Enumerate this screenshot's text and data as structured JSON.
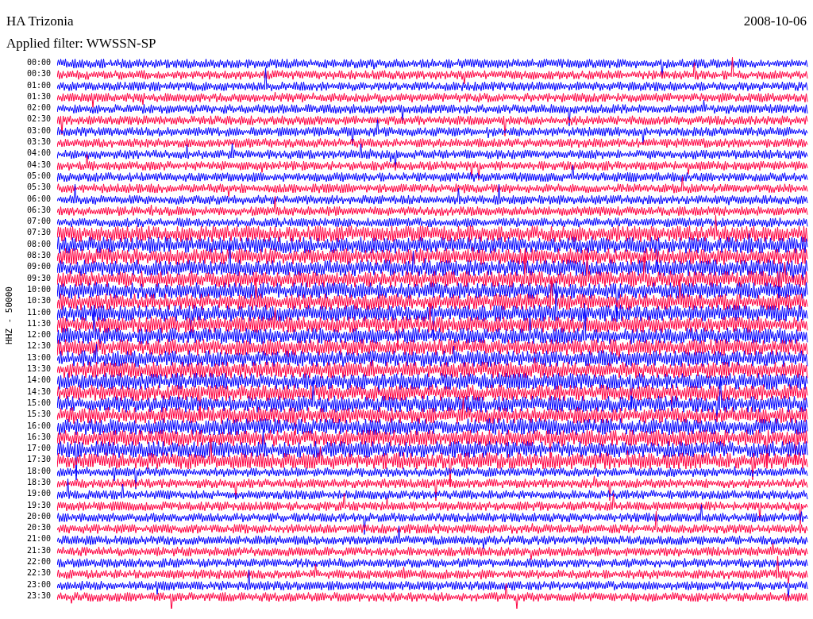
{
  "header": {
    "station": "HA Trizonia",
    "date": "2008-10-06",
    "filter": "Applied filter: WWSSN-SP"
  },
  "axis_label": "HHZ - 50000",
  "rows": [
    {
      "time": "00:00",
      "color": "#0000ff"
    },
    {
      "time": "00:30",
      "color": "#ff0040"
    },
    {
      "time": "01:00",
      "color": "#0000ff"
    },
    {
      "time": "01:30",
      "color": "#ff0040"
    },
    {
      "time": "02:00",
      "color": "#0000ff"
    },
    {
      "time": "02:30",
      "color": "#ff0040"
    },
    {
      "time": "03:00",
      "color": "#0000ff"
    },
    {
      "time": "03:30",
      "color": "#ff0040"
    },
    {
      "time": "04:00",
      "color": "#0000ff"
    },
    {
      "time": "04:30",
      "color": "#ff0040"
    },
    {
      "time": "05:00",
      "color": "#0000ff"
    },
    {
      "time": "05:30",
      "color": "#ff0040"
    },
    {
      "time": "06:00",
      "color": "#0000ff"
    },
    {
      "time": "06:30",
      "color": "#ff0040"
    },
    {
      "time": "07:00",
      "color": "#0000ff"
    },
    {
      "time": "07:30",
      "color": "#ff0040"
    },
    {
      "time": "08:00",
      "color": "#0000ff"
    },
    {
      "time": "08:30",
      "color": "#ff0040"
    },
    {
      "time": "09:00",
      "color": "#0000ff"
    },
    {
      "time": "09:30",
      "color": "#ff0040"
    },
    {
      "time": "10:00",
      "color": "#0000ff"
    },
    {
      "time": "10:30",
      "color": "#ff0040"
    },
    {
      "time": "11:00",
      "color": "#0000ff"
    },
    {
      "time": "11:30",
      "color": "#ff0040"
    },
    {
      "time": "12:00",
      "color": "#0000ff"
    },
    {
      "time": "12:30",
      "color": "#ff0040"
    },
    {
      "time": "13:00",
      "color": "#0000ff"
    },
    {
      "time": "13:30",
      "color": "#ff0040"
    },
    {
      "time": "14:00",
      "color": "#0000ff"
    },
    {
      "time": "14:30",
      "color": "#ff0040"
    },
    {
      "time": "15:00",
      "color": "#0000ff"
    },
    {
      "time": "15:30",
      "color": "#ff0040"
    },
    {
      "time": "16:00",
      "color": "#0000ff"
    },
    {
      "time": "16:30",
      "color": "#ff0040"
    },
    {
      "time": "17:00",
      "color": "#0000ff"
    },
    {
      "time": "17:30",
      "color": "#ff0040"
    },
    {
      "time": "18:00",
      "color": "#0000ff"
    },
    {
      "time": "18:30",
      "color": "#ff0040"
    },
    {
      "time": "19:00",
      "color": "#0000ff"
    },
    {
      "time": "19:30",
      "color": "#ff0040"
    },
    {
      "time": "20:00",
      "color": "#0000ff"
    },
    {
      "time": "20:30",
      "color": "#ff0040"
    },
    {
      "time": "21:00",
      "color": "#0000ff"
    },
    {
      "time": "21:30",
      "color": "#ff0040"
    },
    {
      "time": "22:00",
      "color": "#0000ff"
    },
    {
      "time": "22:30",
      "color": "#ff0040"
    },
    {
      "time": "23:00",
      "color": "#0000ff"
    },
    {
      "time": "23:30",
      "color": "#ff0040"
    }
  ]
}
